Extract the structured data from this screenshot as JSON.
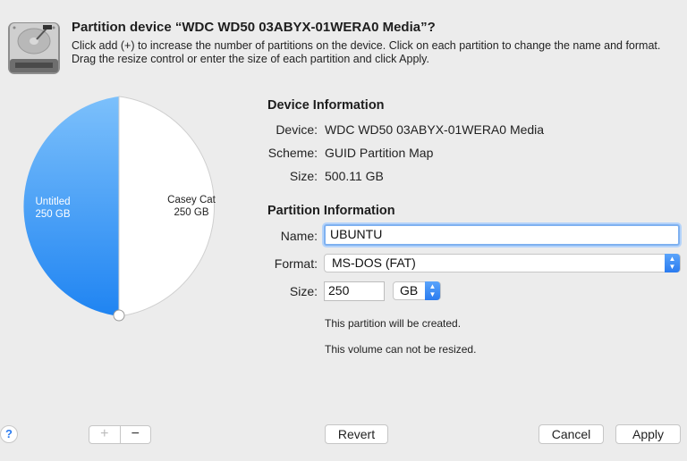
{
  "dialog": {
    "title": "Partition device “WDC WD50 03ABYX-01WERA0 Media”?",
    "description": "Click add (+) to increase the number of partitions on the device. Click on each partition to change the name and format. Drag the resize control or enter the size of each partition and click Apply."
  },
  "pie": {
    "partitions": [
      {
        "name": "Untitled",
        "size": "250 GB",
        "fraction": 0.5,
        "color": "#2f8df3"
      },
      {
        "name": "Casey Cat",
        "size": "250 GB",
        "fraction": 0.5,
        "color": "#ffffff"
      }
    ]
  },
  "device_info": {
    "title": "Device Information",
    "device_label": "Device:",
    "device_value": "WDC WD50 03ABYX-01WERA0 Media",
    "scheme_label": "Scheme:",
    "scheme_value": "GUID Partition Map",
    "size_label": "Size:",
    "size_value": "500.11 GB"
  },
  "partition_info": {
    "title": "Partition Information",
    "name_label": "Name:",
    "name_value": "UBUNTU",
    "format_label": "Format:",
    "format_value": "MS-DOS (FAT)",
    "size_label": "Size:",
    "size_value": "250",
    "unit_value": "GB",
    "note_created": "This partition will be created.",
    "note_resize": "This volume can not be resized."
  },
  "footer": {
    "help_label": "?",
    "add_label": "+",
    "remove_label": "−",
    "revert_label": "Revert",
    "cancel_label": "Cancel",
    "apply_label": "Apply"
  },
  "icons": {
    "disk": "hard-disk-icon",
    "help": "help-icon",
    "resize_handle": "resize-handle"
  }
}
